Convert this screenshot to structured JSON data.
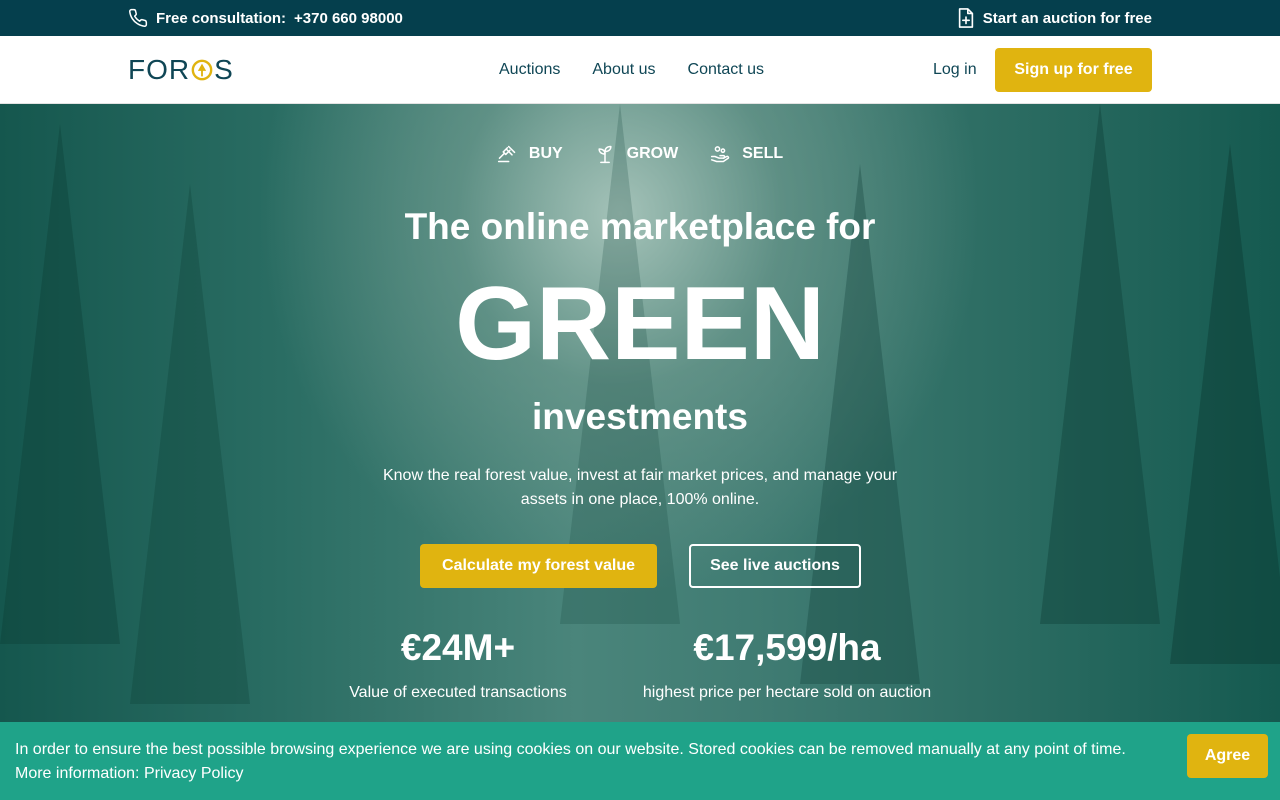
{
  "topbar": {
    "consultation_label": "Free consultation:",
    "phone": "+370 660 98000",
    "auction_link": "Start an auction for free"
  },
  "nav": {
    "logo": "FOROS",
    "links": [
      "Auctions",
      "About us",
      "Contact us"
    ],
    "login": "Log in",
    "signup": "Sign up for free"
  },
  "hero": {
    "pillars": [
      "BUY",
      "GROW",
      "SELL"
    ],
    "heading_line1": "The online marketplace for",
    "heading_big": "GREEN",
    "heading_line3": "investments",
    "subtitle": "Know the real forest value, invest at fair market prices, and manage your assets in one place, 100% online.",
    "cta_primary": "Calculate my forest value",
    "cta_secondary": "See live auctions",
    "stats": [
      {
        "value": "€24M+",
        "label": "Value of executed transactions"
      },
      {
        "value": "€17,599/ha",
        "label": "highest price per hectare sold on auction"
      }
    ]
  },
  "cookie": {
    "text": "In order to ensure the best possible browsing experience we are using cookies on our website. Stored cookies can be removed manually at any point of time. More information: Privacy Policy",
    "agree": "Agree"
  },
  "colors": {
    "topbar": "#053f4d",
    "accent": "#e0b410",
    "nav_text": "#0f4655",
    "cookie_bg": "#1fa389"
  }
}
